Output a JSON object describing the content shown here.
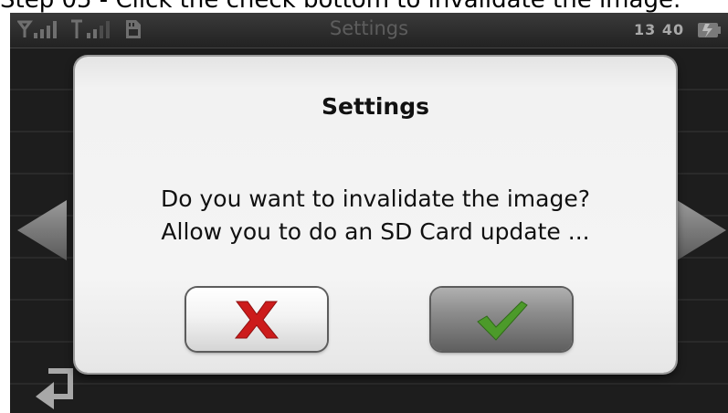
{
  "caption": "Step 05 - Click the check bottom to invalidate the image.",
  "statusbar": {
    "title": "Settings",
    "clock": "13 40",
    "icons": [
      "satellite-signal-icon",
      "antenna-signal-icon",
      "sd-card-icon",
      "battery-icon"
    ]
  },
  "dialog": {
    "title": "Settings",
    "message_line1": "Do you want to invalidate the image?",
    "message_line2": "Allow you to do an SD Card update ...",
    "cancel_icon": "red-x-icon",
    "confirm_icon": "green-check-icon"
  },
  "navigation": {
    "left_icon": "left-arrow-icon",
    "right_icon": "right-arrow-icon",
    "back_icon": "back-return-icon"
  },
  "colors": {
    "cancel_mark": "#cc1b1b",
    "confirm_mark": "#4c9a2a",
    "dialog_bg": "#f2f2f2",
    "screen_bg": "#1b1b1b"
  }
}
